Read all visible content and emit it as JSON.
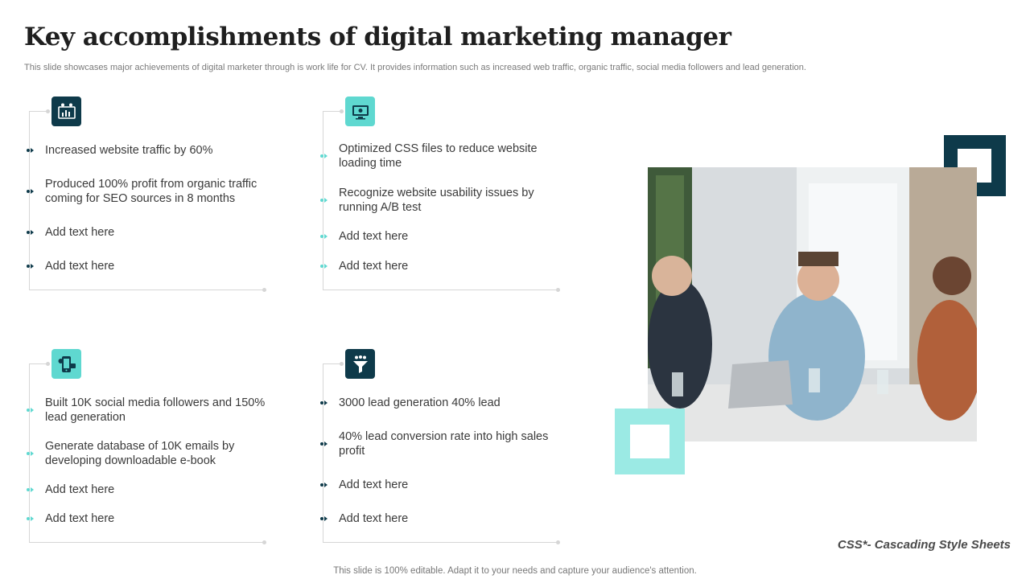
{
  "slide": {
    "title": "Key accomplishments of digital marketing manager",
    "subtitle": "This slide showcases major achievements of digital marketer through is work life for CV. It provides information such as increased web traffic, organic traffic, social media followers and lead generation.",
    "footnote": "CSS*- Cascading Style Sheets",
    "footer": "This slide is 100% editable. Adapt it to your needs and capture your audience's attention."
  },
  "colors": {
    "accent_dark": "#0e3a4a",
    "accent_teal": "#5fd8d0",
    "accent_light_teal": "#9beae4"
  },
  "cards": [
    {
      "icon": "analytics-presentation-icon",
      "items": [
        "Increased website traffic  by 60%",
        "Produced 100% profit from organic traffic coming for SEO sources in 8 months",
        "Add text here",
        "Add text here"
      ]
    },
    {
      "icon": "monitor-icon",
      "items": [
        "Optimized CSS files to reduce website loading time",
        "Recognize website usability issues by running A/B test",
        "Add text here",
        "Add text here"
      ]
    },
    {
      "icon": "social-media-phone-icon",
      "items": [
        "Built 10K social media followers and 150% lead generation",
        "Generate database of 10K emails by developing downloadable e-book",
        "Add text here",
        "Add text here"
      ]
    },
    {
      "icon": "lead-funnel-icon",
      "items": [
        "3000 lead generation 40% lead",
        "40% lead conversion rate into high sales profit",
        "Add text here",
        "Add text here"
      ]
    }
  ]
}
